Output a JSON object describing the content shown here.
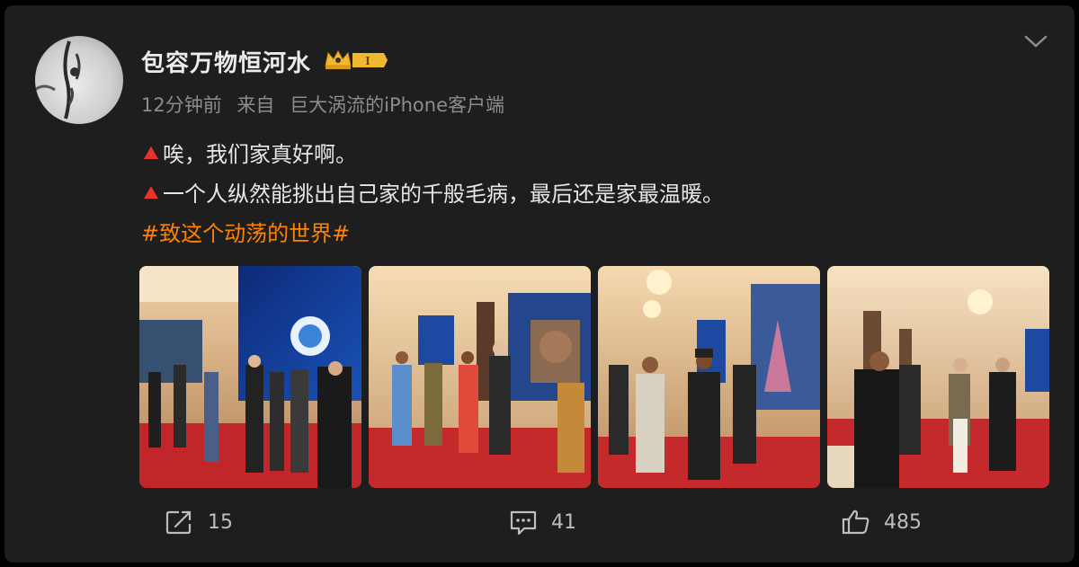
{
  "post": {
    "username": "包容万物恒河水",
    "vip_level": "I",
    "time": "12分钟前",
    "source_prefix": "来自",
    "source": "巨大涡流的iPhone客户端",
    "lines": [
      "唉，我们家真好啊。",
      "一个人纵然能挑出自己家的千般毛病，最后还是家最温暖。"
    ],
    "hashtag": "#致这个动荡的世界#"
  },
  "actions": {
    "repost_count": "15",
    "comment_count": "41",
    "like_count": "485"
  },
  "colors": {
    "background": "#000000",
    "card": "#1e1e1e",
    "hashtag": "#ff8200",
    "bullet": "#e8332a",
    "badge": "#f2b830"
  },
  "icons": [
    "chevron-down-icon",
    "red-triangle-icon",
    "repost-icon",
    "comment-icon",
    "like-icon",
    "crown-icon"
  ]
}
